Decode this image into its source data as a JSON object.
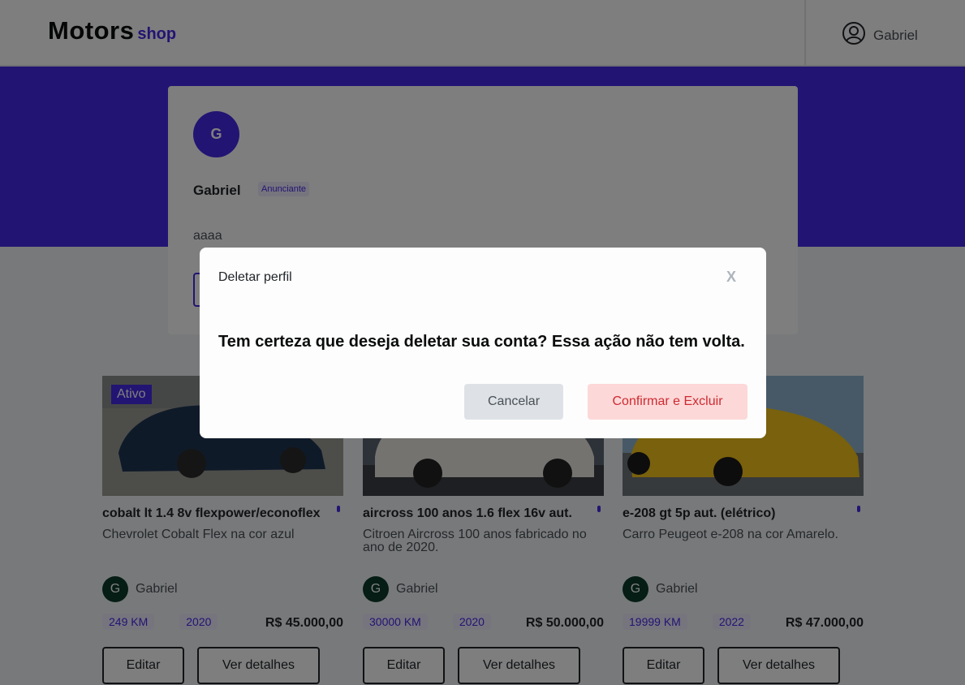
{
  "header": {
    "logo_main": "Motors",
    "logo_sub": "shop",
    "user_name": "Gabriel"
  },
  "profile": {
    "avatar_initial": "G",
    "name": "Gabriel",
    "badge": "Anunciante",
    "description": "aaaa"
  },
  "products": [
    {
      "status": "Ativo",
      "title": "cobalt lt 1.4 8v flexpower/econoflex",
      "description": "Chevrolet Cobalt Flex na cor azul",
      "seller_initial": "G",
      "seller": "Gabriel",
      "km": "249 KM",
      "year": "2020",
      "price": "R$ 45.000,00",
      "edit_label": "Editar",
      "details_label": "Ver detalhes",
      "car_color": "#1f3553"
    },
    {
      "status": "",
      "title": "aircross 100 anos 1.6 flex 16v aut.",
      "description": "Citroen Aircross 100 anos fabricado no ano de 2020.",
      "seller_initial": "G",
      "seller": "Gabriel",
      "km": "30000 KM",
      "year": "2020",
      "price": "R$ 50.000,00",
      "edit_label": "Editar",
      "details_label": "Ver detalhes",
      "car_color": "#e8e6e0"
    },
    {
      "status": "",
      "title": "e-208 gt 5p aut. (elétrico)",
      "description": "Carro Peugeot e-208 na cor Amarelo.",
      "seller_initial": "G",
      "seller": "Gabriel",
      "km": "19999 KM",
      "year": "2022",
      "price": "R$ 47.000,00",
      "edit_label": "Editar",
      "details_label": "Ver detalhes",
      "car_color": "#f2c21b"
    }
  ],
  "modal": {
    "title": "Deletar perfil",
    "close_label": "X",
    "message": "Tem certeza que deseja deletar sua conta? Essa ação não tem volta.",
    "cancel_label": "Cancelar",
    "confirm_label": "Confirmar e Excluir"
  },
  "colors": {
    "brand": "#4529e6",
    "danger_bg": "#fdd8d8",
    "danger_text": "#cd2b31"
  }
}
